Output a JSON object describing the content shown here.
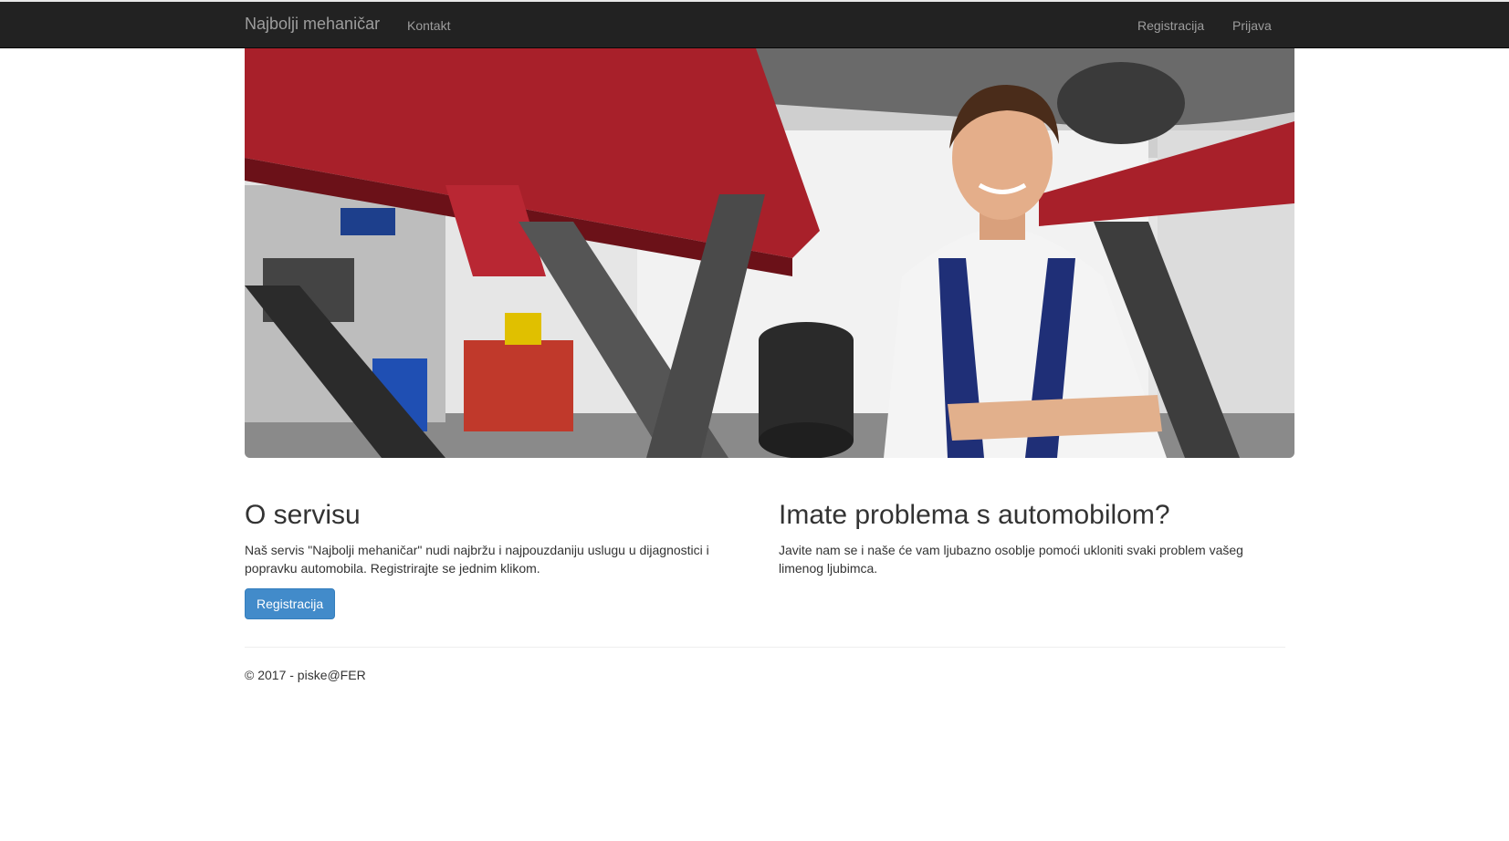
{
  "navbar": {
    "brand": "Najbolji mehaničar",
    "left_links": [
      {
        "label": "Kontakt"
      }
    ],
    "right_links": [
      {
        "label": "Registracija"
      },
      {
        "label": "Prijava"
      }
    ]
  },
  "hero": {
    "image": "mechanic-in-garage-photo"
  },
  "sections": {
    "about": {
      "heading": "O servisu",
      "text": "Naš servis \"Najbolji mehaničar\" nudi najbržu i najpouzdaniju uslugu u dijagnostici i popravku automobila. Registrirajte se jednim klikom.",
      "button_label": "Registracija"
    },
    "problem": {
      "heading": "Imate problema s automobilom?",
      "text": "Javite nam se i naše će vam ljubazno osoblje pomoći ukloniti svaki problem vašeg limenog ljubimca."
    }
  },
  "footer": {
    "text": "© 2017 - piske@FER"
  },
  "colors": {
    "navbar_bg": "#222222",
    "nav_text": "#9d9d9d",
    "primary_button": "#428bca"
  }
}
